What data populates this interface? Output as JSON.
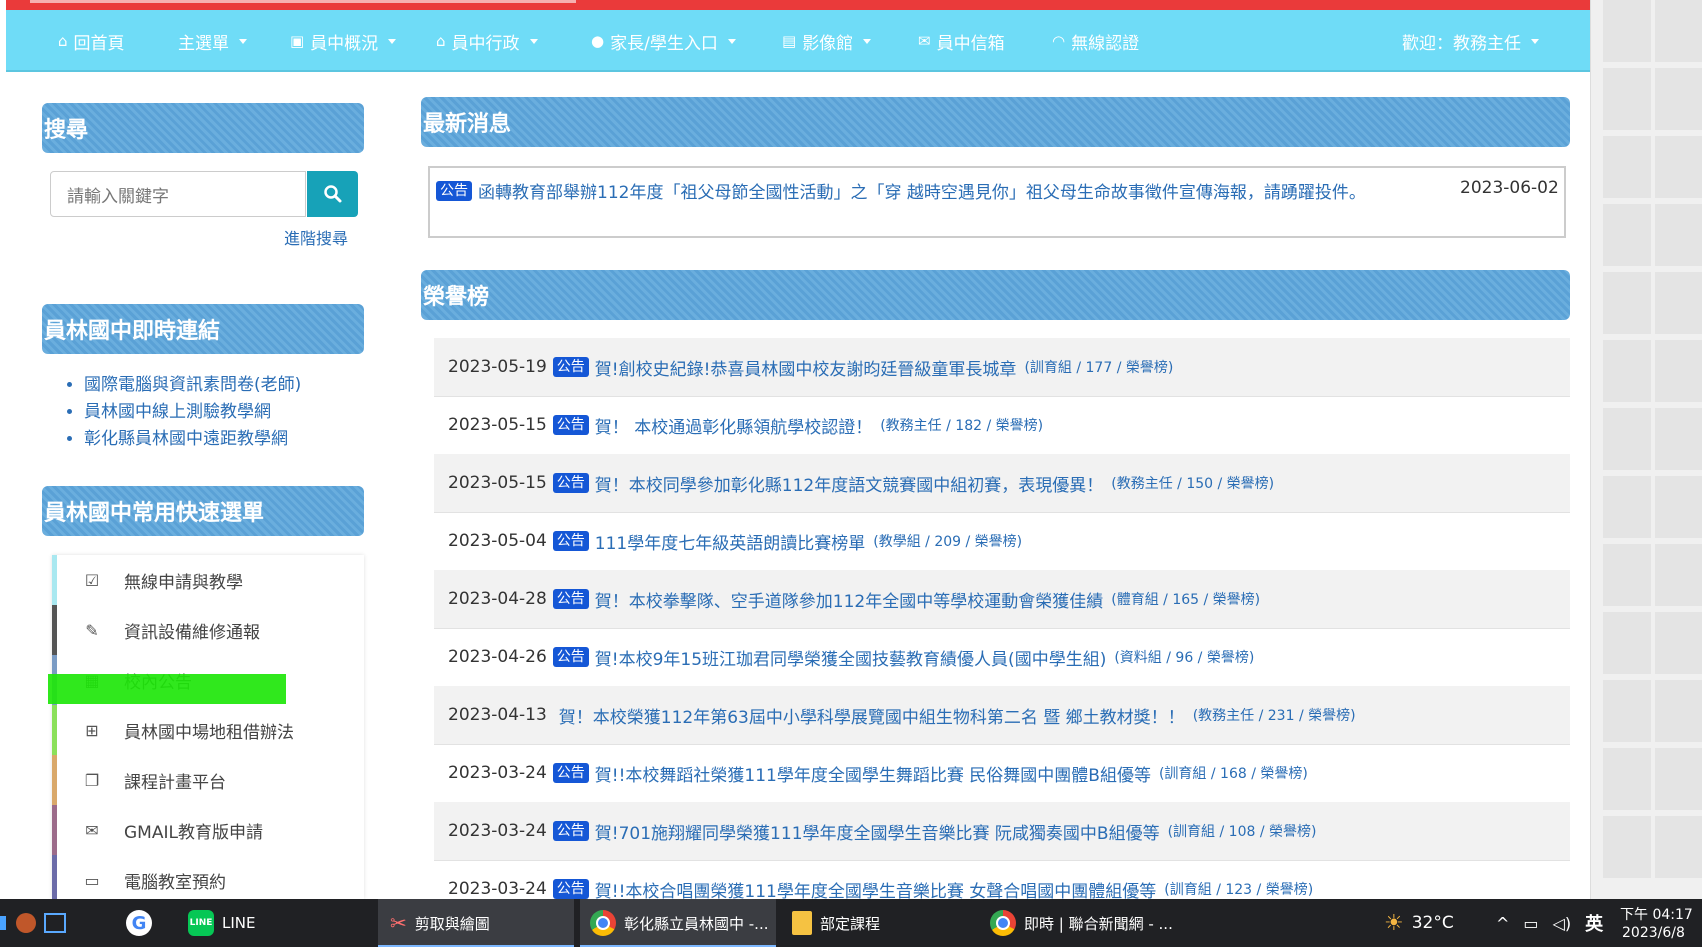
{
  "nav": {
    "home": "回首頁",
    "main_menu": "主選單",
    "overview": "員中概況",
    "admin": "員中行政",
    "parents": "家長/學生入口",
    "gallery": "影像館",
    "mailbox": "員中信箱",
    "wifi": "無線認證",
    "welcome": "歡迎：教務主任"
  },
  "sidebar": {
    "search_title": "搜尋",
    "search_placeholder": "請輸入關鍵字",
    "advanced_search": "進階搜尋",
    "links_title": "員林國中即時連結",
    "links": [
      "國際電腦與資訊素問卷(老師)",
      "員林國中線上測驗教學網",
      "彰化縣員林國中遠距教學網"
    ],
    "quick_title": "員林國中常用快速選單",
    "quick_items": [
      {
        "label": "無線申請與教學",
        "icon": "check-square-icon",
        "color": "#a9e8f0"
      },
      {
        "label": "資訊設備維修通報",
        "icon": "wrench-icon",
        "color": "#555555"
      },
      {
        "label": "校內公告",
        "icon": "calendar-icon",
        "color": "#7a9bc4"
      },
      {
        "label": "員林國中場地租借辦法",
        "icon": "sitemap-icon",
        "color": "#8be05a"
      },
      {
        "label": "課程計畫平台",
        "icon": "copy-icon",
        "color": "#d9a86a"
      },
      {
        "label": "GMAIL教育版申請",
        "icon": "envelope-icon",
        "color": "#9c6b8a"
      },
      {
        "label": "電腦教室預約",
        "icon": "laptop-icon",
        "color": "#6b6ba8"
      }
    ]
  },
  "news": {
    "title": "最新消息",
    "badge": "公告",
    "item_title": "函轉教育部舉辦112年度「祖父母節全國性活動」之「穿 越時空遇見你」祖父母生命故事徵件宣傳海報，請踴躍投件。",
    "item_date": "2023-06-02"
  },
  "honor": {
    "title": "榮譽榜",
    "badge": "公告",
    "rows": [
      {
        "date": "2023-05-19",
        "badge": true,
        "title": "賀!創校史紀錄!恭喜員林國中校友謝昀廷晉級童軍長城章",
        "meta": "(訓育組 / 177 / 榮譽榜)"
      },
      {
        "date": "2023-05-15",
        "badge": true,
        "title": "賀！ 本校通過彰化縣領航學校認證！",
        "meta": "(教務主任 / 182 / 榮譽榜)"
      },
      {
        "date": "2023-05-15",
        "badge": true,
        "title": "賀！本校同學參加彰化縣112年度語文競賽國中組初賽，表現優異！",
        "meta": "(教務主任 / 150 / 榮譽榜)"
      },
      {
        "date": "2023-05-04",
        "badge": true,
        "title": "111學年度七年級英語朗讀比賽榜單",
        "meta": "(教學組 / 209 / 榮譽榜)"
      },
      {
        "date": "2023-04-28",
        "badge": true,
        "title": "賀！本校拳擊隊、空手道隊參加112年全國中等學校運動會榮獲佳績",
        "meta": "(體育組 / 165 / 榮譽榜)"
      },
      {
        "date": "2023-04-26",
        "badge": true,
        "title": "賀!本校9年15班江珈君同學榮獲全國技藝教育績優人員(國中學生組)",
        "meta": "(資料組 / 96 / 榮譽榜)"
      },
      {
        "date": "2023-04-13",
        "badge": false,
        "title": "賀！本校榮獲112年第63屆中小學科學展覽國中組生物科第二名 暨 鄉土教材獎！！",
        "meta": "(教務主任 / 231 / 榮譽榜)"
      },
      {
        "date": "2023-03-24",
        "badge": true,
        "title": "賀!!本校舞蹈社榮獲111學年度全國學生舞蹈比賽 民俗舞國中團體B組優等",
        "meta": "(訓育組 / 168 / 榮譽榜)"
      },
      {
        "date": "2023-03-24",
        "badge": true,
        "title": "賀!701施翔耀同學榮獲111學年度全國學生音樂比賽 阮咸獨奏國中B組優等",
        "meta": "(訓育組 / 108 / 榮譽榜)"
      },
      {
        "date": "2023-03-24",
        "badge": true,
        "title": "賀!!本校合唱團榮獲111學年度全國學生音樂比賽 女聲合唱國中團體組優等",
        "meta": "(訓育組 / 123 / 榮譽榜)"
      }
    ]
  },
  "taskbar": {
    "line": "LINE",
    "snip": "剪取與繪圖",
    "chrome1": "彰化縣立員林國中 -...",
    "folder": "部定課程",
    "chrome2": "即時 | 聯合新聞網 - ...",
    "temp": "32°C",
    "ime": "英",
    "time": "下午 04:17",
    "date": "2023/6/8"
  }
}
